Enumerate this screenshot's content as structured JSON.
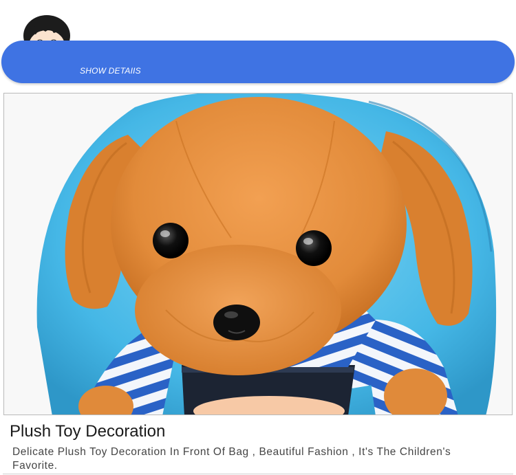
{
  "banner": {
    "label": "SHOW DETAIIS",
    "color": "#3f73e3"
  },
  "mascot": {
    "icon": "cartoon-boy-icon"
  },
  "product_image": {
    "subject": "plush-dog-backpack-photo"
  },
  "section": {
    "title": "Plush Toy Decoration",
    "description": "Delicate Plush Toy Decoration In Front Of Bag , Beautiful Fashion , It's The Children's Favorite."
  }
}
